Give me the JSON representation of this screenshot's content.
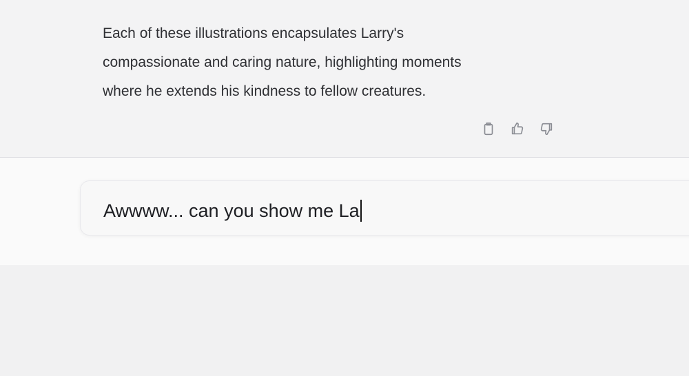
{
  "conversation": {
    "assistant_message": {
      "lines": [
        "Each of these illustrations encapsulates Larry's",
        "compassionate and caring nature, highlighting moments",
        "where he extends his kindness to fellow creatures."
      ]
    },
    "actions": [
      {
        "icon": "clipboard-icon"
      },
      {
        "icon": "thumbs-up-icon"
      },
      {
        "icon": "thumbs-down-icon"
      }
    ]
  },
  "composer": {
    "value": "Awwww... can you show me La"
  }
}
